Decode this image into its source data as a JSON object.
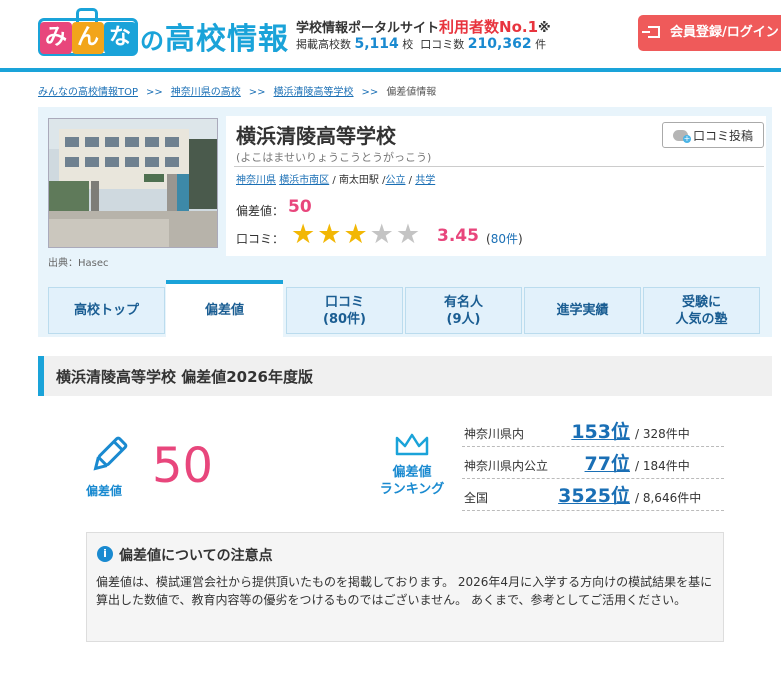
{
  "header": {
    "logo_chars": [
      "み",
      "ん",
      "な"
    ],
    "logo_colors": [
      "#e8467c",
      "#f2a51a",
      "#1aa3d9"
    ],
    "logo_no": "の",
    "logo_rest": "高校情報",
    "tagline_prefix": "学校情報ポータルサイト",
    "tagline_highlight": "利用者数No.1",
    "tagline_suffix": "※",
    "stat1_label": "掲載高校数",
    "stat1_value": "5,114",
    "stat1_unit": "校",
    "stat2_label": "口コミ数",
    "stat2_value": "210,362",
    "stat2_unit": "件",
    "register_label": "会員登録/ログイン"
  },
  "breadcrumb": [
    "みんなの高校情報TOP",
    "神奈川県の高校",
    "横浜清陵高等学校",
    "偏差値情報"
  ],
  "breadcrumb_sep": ">>",
  "school": {
    "name": "横浜清陵高等学校",
    "kana": "(よこはませいりょうこうとうがっこう)",
    "pref": "神奈川県",
    "city": "横浜市南区",
    "station": "南太田駅",
    "type": "公立",
    "gender": "共学",
    "photo_credit_label": "出典：",
    "photo_credit": "Hasec",
    "review_button": "口コミ投稿",
    "hensachi_label": "偏差値：",
    "hensachi": "50",
    "kuchikomi_label": "口コミ：",
    "rating": 3.45,
    "rating_text": "3.45",
    "review_count": "80件",
    "stars": [
      "★",
      "★",
      "★",
      "★",
      "★"
    ]
  },
  "tabs": [
    {
      "label": "高校トップ",
      "active": false
    },
    {
      "label": "偏差値",
      "active": true
    },
    {
      "label": "口コミ\n(80件)",
      "active": false
    },
    {
      "label": "有名人\n(9人)",
      "active": false
    },
    {
      "label": "進学実績",
      "active": false
    },
    {
      "label": "受験に\n人気の塾",
      "active": false
    }
  ],
  "section": {
    "title": "横浜清陵高等学校 偏差値2026年度版"
  },
  "score": {
    "label": "偏差値",
    "value": "50",
    "ranking_label_1": "偏差値",
    "ranking_label_2": "ランキング",
    "rankings": [
      {
        "name": "神奈川県内",
        "rank": "153位",
        "total": "/ 328件中"
      },
      {
        "name": "神奈川県内公立",
        "rank": "77位",
        "total": "/ 184件中"
      },
      {
        "name": "全国",
        "rank": "3525位",
        "total": "/ 8,646件中"
      }
    ]
  },
  "note": {
    "icon": "i",
    "title": "偏差値についての注意点",
    "body": "偏差値は、模試運営会社から提供頂いたものを掲載しております。 2026年4月に入学する方向けの模試結果を基に算出した数値で、教育内容等の優劣をつけるものではございません。 あくまで、参考としてご活用ください。"
  },
  "colors": {
    "accent": "#1aa3d9",
    "highlight": "#e8467c",
    "star": "#f2b705",
    "register": "#ef5a5a"
  }
}
